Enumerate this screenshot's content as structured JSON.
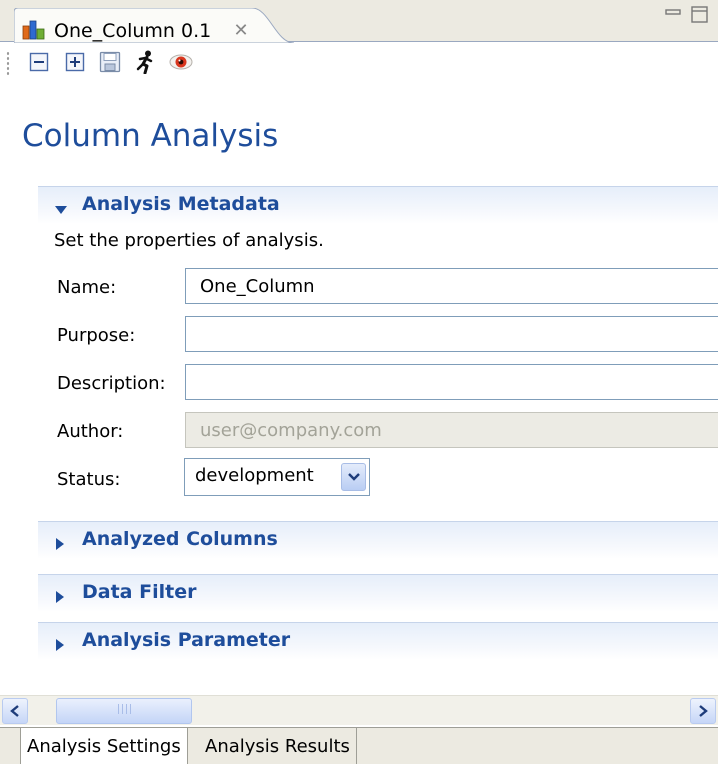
{
  "editor_tab": {
    "title": "One_Column 0.1",
    "icon": "chart-icon"
  },
  "window_controls": {
    "minimize_icon": "minimize-icon",
    "maximize_icon": "maximize-icon"
  },
  "toolbar": {
    "buttons": [
      {
        "icon": "collapse-all-icon"
      },
      {
        "icon": "expand-all-icon"
      },
      {
        "icon": "save-icon"
      },
      {
        "icon": "run-icon"
      },
      {
        "icon": "eye-icon"
      }
    ]
  },
  "form": {
    "title": "Column Analysis",
    "sections": {
      "metadata": {
        "title": "Analysis Metadata",
        "expanded": true,
        "description": "Set the properties of analysis.",
        "fields": {
          "name_label": "Name:",
          "name_value": "One_Column",
          "purpose_label": "Purpose:",
          "purpose_value": "",
          "description_label": "Description:",
          "description_value": "",
          "author_label": "Author:",
          "author_value": "user@company.com",
          "status_label": "Status:",
          "status_value": "development"
        }
      },
      "analyzed_columns": {
        "title": "Analyzed Columns",
        "expanded": false
      },
      "data_filter": {
        "title": "Data Filter",
        "expanded": false
      },
      "analysis_parameter": {
        "title": "Analysis Parameter",
        "expanded": false
      }
    }
  },
  "bottom_tabs": [
    {
      "label": "Analysis Settings",
      "active": true
    },
    {
      "label": "Analysis Results",
      "active": false
    }
  ],
  "colors": {
    "title_blue": "#1e4d9b",
    "tab_bar": "#eceae1",
    "section_gradient": "#e6eefa"
  }
}
